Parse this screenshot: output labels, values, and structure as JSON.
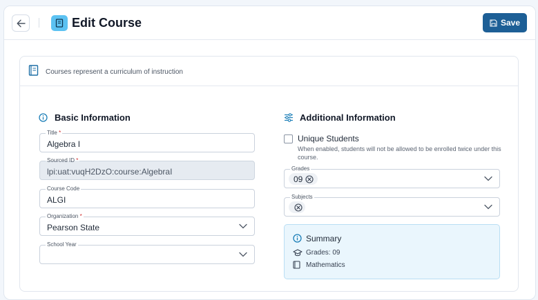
{
  "header": {
    "title": "Edit Course",
    "save_label": "Save",
    "back_icon": "arrow-left-icon",
    "title_icon": "book-icon"
  },
  "card": {
    "description": "Courses represent a curriculum of instruction"
  },
  "basic": {
    "title": "Basic Information",
    "fields": {
      "title": {
        "label": "Title",
        "required": "*",
        "value": "Algebra I"
      },
      "sourced_id": {
        "label": "Sourced ID",
        "required": "*",
        "value": "lpi:uat:vuqH2DzO:course:AlgebraI"
      },
      "course_code": {
        "label": "Course Code",
        "value": "ALGI"
      },
      "organization": {
        "label": "Organization",
        "required": "*",
        "value": "Pearson State"
      },
      "school_year": {
        "label": "School Year",
        "value": ""
      }
    }
  },
  "additional": {
    "title": "Additional Information",
    "unique_students": {
      "label": "Unique Students",
      "help": "When enabled, students will not be allowed to be enrolled twice under this course.",
      "checked": false
    },
    "grades": {
      "label": "Grades",
      "chips": [
        "09"
      ]
    },
    "subjects": {
      "label": "Subjects",
      "chips": [
        ""
      ]
    }
  },
  "summary": {
    "title": "Summary",
    "grades_line": "Grades: 09",
    "subject_line": "Mathematics"
  },
  "colors": {
    "primary": "#1d5f96",
    "accent": "#5cc2f2",
    "info": "#1d7fb8",
    "summary_bg": "#eaf6fd"
  }
}
